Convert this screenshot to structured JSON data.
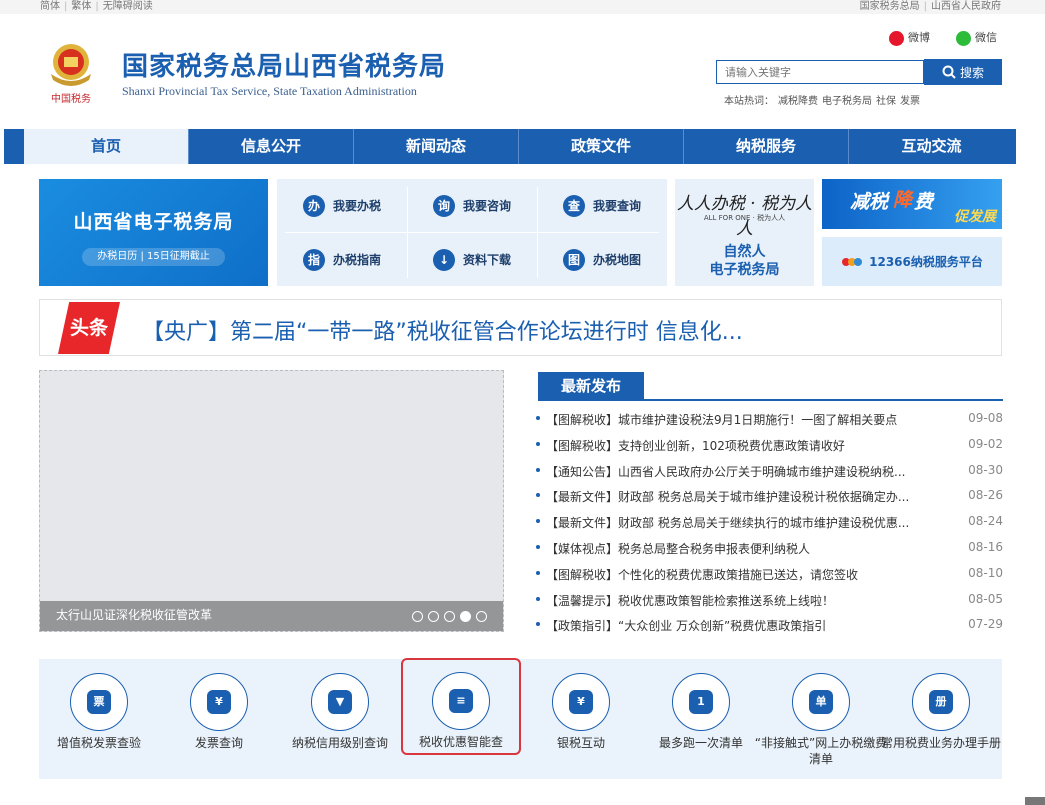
{
  "topbar": {
    "lang": [
      "简体",
      "繁体",
      "无障碍阅读"
    ],
    "links": [
      "国家税务总局",
      "山西省人民政府"
    ]
  },
  "header": {
    "title": "国家税务总局山西省税务局",
    "subtitle": "Shanxi Provincial Tax Service, State Taxation Administration",
    "emblem_text": "中国税务",
    "weibo": "微博",
    "wechat": "微信",
    "search_placeholder": "请输入关键字",
    "search_button": "搜索",
    "hot_label": "本站热词：",
    "hot_words": [
      "减税降费",
      "电子税务局",
      "社保",
      "发票"
    ]
  },
  "nav": [
    "首页",
    "信息公开",
    "新闻动态",
    "政策文件",
    "纳税服务",
    "互动交流"
  ],
  "tiles": {
    "etax_title": "山西省电子税务局",
    "etax_sub": "办税日历 | 15日征期截止",
    "services": [
      {
        "label": "我要办税",
        "icon": "办"
      },
      {
        "label": "我要咨询",
        "icon": "询"
      },
      {
        "label": "我要查询",
        "icon": "查"
      },
      {
        "label": "办税指南",
        "icon": "指"
      },
      {
        "label": "资料下载",
        "icon": "↓"
      },
      {
        "label": "办税地图",
        "icon": "图"
      }
    ],
    "natural_slogan": "人人办税 · 税为人人",
    "natural_slogan_sub": "ALL FOR ONE · 税为人人",
    "natural_line1": "自然人",
    "natural_line2": "电子税务局",
    "reduce_a": "减税",
    "reduce_b": "降",
    "reduce_c": "费",
    "reduce_d": "促发展",
    "hotline": "12366纳税服务平台"
  },
  "headline": {
    "badge": "头条",
    "text": "【央广】第二届“一带一路”税收征管合作论坛进行时 信息化..."
  },
  "photo": {
    "caption": "太行山见证深化税收征管改革",
    "dots": 5,
    "active_dot": 4
  },
  "news": {
    "tab": "最新发布",
    "items": [
      {
        "title": "【图解税收】城市维护建设税法9月1日期施行！一图了解相关要点",
        "date": "09-08"
      },
      {
        "title": "【图解税收】支持创业创新，102项税费优惠政策请收好",
        "date": "09-02"
      },
      {
        "title": "【通知公告】山西省人民政府办公厅关于明确城市维护建设税纳税...",
        "date": "08-30"
      },
      {
        "title": "【最新文件】财政部 税务总局关于城市维护建设税计税依据确定办...",
        "date": "08-26"
      },
      {
        "title": "【最新文件】财政部 税务总局关于继续执行的城市维护建设税优惠...",
        "date": "08-24"
      },
      {
        "title": "【媒体视点】税务总局整合税务申报表便利纳税人",
        "date": "08-16"
      },
      {
        "title": "【图解税收】个性化的税费优惠政策措施已送达，请您签收",
        "date": "08-10"
      },
      {
        "title": "【温馨提示】税收优惠政策智能检索推送系统上线啦！",
        "date": "08-05"
      },
      {
        "title": "【政策指引】“大众创业 万众创新”税费优惠政策指引",
        "date": "07-29"
      }
    ]
  },
  "services_strip": [
    {
      "label": "增值税发票查验",
      "icon": "票"
    },
    {
      "label": "发票查询",
      "icon": "¥"
    },
    {
      "label": "纳税信用级别查询",
      "icon": "▼"
    },
    {
      "label": "税收优惠智能查",
      "icon": "≡"
    },
    {
      "label": "银税互动",
      "icon": "¥"
    },
    {
      "label": "最多跑一次清单",
      "icon": "1"
    },
    {
      "label": "“非接触式”网上办税缴费清单",
      "icon": "单"
    },
    {
      "label": "常用税费业务办理手册",
      "icon": "册"
    }
  ],
  "colors": {
    "brand_blue": "#1b5fb0",
    "headline_red": "#e8272b",
    "highlight_red": "#d9363e"
  }
}
